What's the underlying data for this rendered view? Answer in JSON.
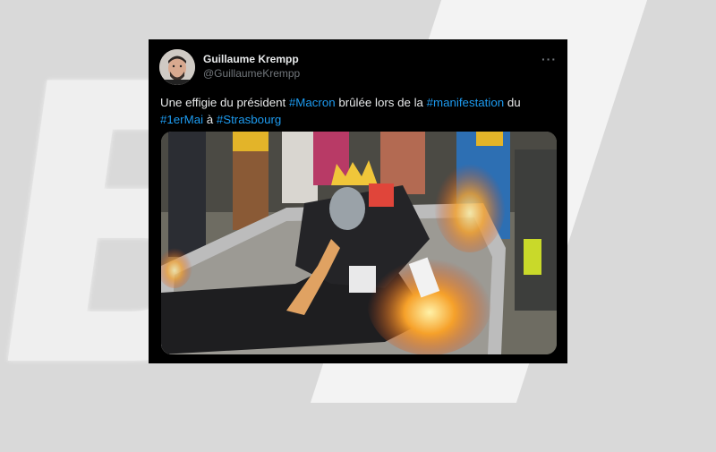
{
  "tweet": {
    "author_name": "Guillaume Krempp",
    "author_handle": "@GuillaumeKrempp",
    "more_label": "···",
    "text_parts": [
      {
        "text": "Une effigie du président ",
        "type": "plain"
      },
      {
        "text": "#Macron",
        "type": "hashtag"
      },
      {
        "text": " brûlée lors de la ",
        "type": "plain"
      },
      {
        "text": "#manifestation",
        "type": "hashtag"
      },
      {
        "text": " du ",
        "type": "plain"
      },
      {
        "text": "#1erMai",
        "type": "hashtag"
      },
      {
        "text": " à ",
        "type": "plain"
      },
      {
        "text": "#Strasbourg",
        "type": "hashtag"
      }
    ],
    "media_description": "effigy-burning-photo"
  },
  "colors": {
    "tweet_background": "#000000",
    "hashtag": "#1d9bf0",
    "name": "#e7e9ea",
    "handle": "#71767b",
    "page_background": "#d9d9d9"
  }
}
